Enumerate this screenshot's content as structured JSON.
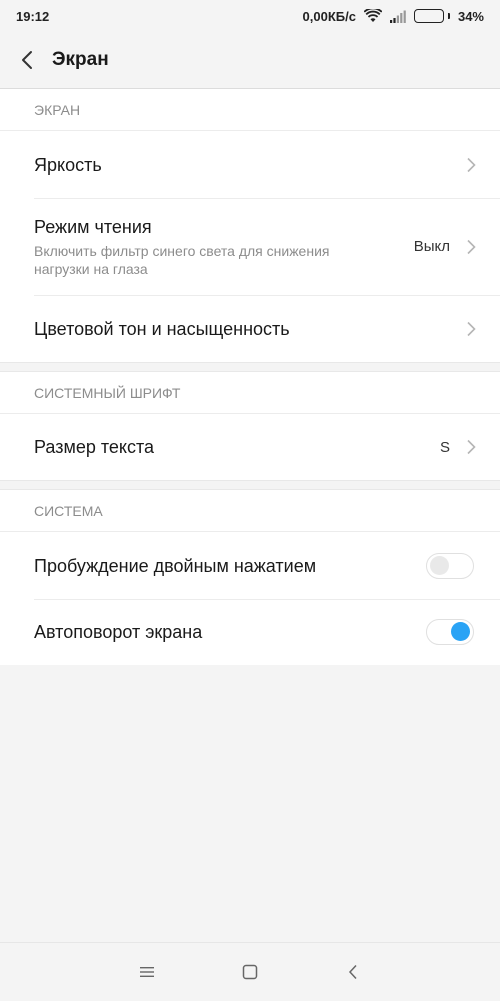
{
  "status_bar": {
    "time": "19:12",
    "network_speed": "0,00КБ/с",
    "battery_percent": "34%",
    "battery_level": 0.34,
    "icons": [
      "wifi-icon",
      "signal-icon",
      "battery-icon"
    ]
  },
  "app_bar": {
    "title": "Экран",
    "back_icon": "back-arrow-icon"
  },
  "sections": [
    {
      "header": "ЭКРАН",
      "items": [
        {
          "title": "Яркость",
          "type": "link"
        },
        {
          "title": "Режим чтения",
          "subtitle": "Включить фильтр синего света для снижения нагрузки на глаза",
          "value": "Выкл",
          "type": "link"
        },
        {
          "title": "Цветовой тон и насыщенность",
          "type": "link"
        }
      ]
    },
    {
      "header": "СИСТЕМНЫЙ ШРИФТ",
      "items": [
        {
          "title": "Размер текста",
          "value": "S",
          "type": "link"
        }
      ]
    },
    {
      "header": "СИСТЕМА",
      "items": [
        {
          "title": "Пробуждение двойным нажатием",
          "type": "toggle",
          "on": false
        },
        {
          "title": "Автоповорот экрана",
          "type": "toggle",
          "on": true
        }
      ]
    }
  ],
  "colors": {
    "toggle_on": "#2aa3f5",
    "background": "#f4f4f4",
    "section_header": "#8c8c8c"
  },
  "nav_bar": {
    "icons": [
      "menu-icon",
      "home-icon",
      "back-icon"
    ]
  }
}
